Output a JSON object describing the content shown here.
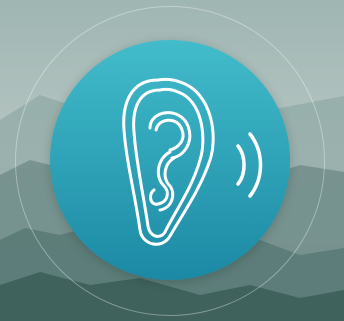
{
  "app": {
    "icon": "ear-icon",
    "secondary_icon": "sound-waves-icon"
  },
  "colors": {
    "disc_top": "#3cb4c4",
    "disc_bottom": "#1f8ea8",
    "background_sky": "#aebfbc",
    "background_mountains": "#6f8a88",
    "background_foreground": "#4d6f69",
    "glyph_stroke": "#ffffff"
  }
}
